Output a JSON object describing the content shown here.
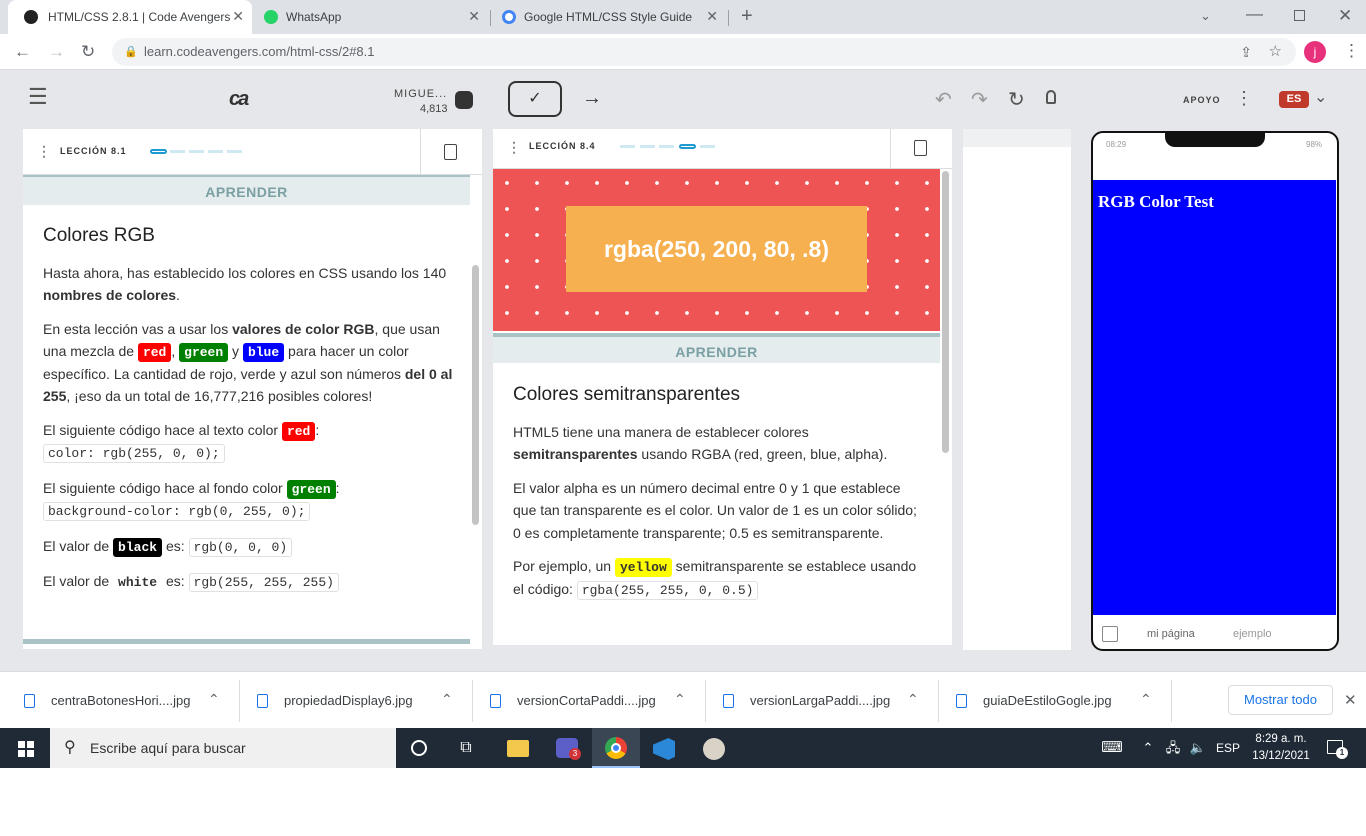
{
  "browser": {
    "tabs": [
      {
        "title": "HTML/CSS 2.8.1 | Code Avengers",
        "icon": "code-avengers-icon",
        "color": "#222222"
      },
      {
        "title": "WhatsApp",
        "icon": "whatsapp-icon",
        "color": "#25d366"
      },
      {
        "title": "Google HTML/CSS Style Guide",
        "icon": "google-icon",
        "color": "#4285f4"
      }
    ],
    "url": "learn.codeavengers.com/html-css/2#8.1",
    "profile_initial": "j"
  },
  "app": {
    "logo": "ca",
    "user_name": "MIGUE...",
    "user_points": "4,813",
    "support_label": "APOYO",
    "language": "ES"
  },
  "left_panel": {
    "lesson_label": "LECCIÓN 8.1",
    "section_label": "APRENDER",
    "title": "Colores RGB",
    "p1_a": "Hasta ahora, has establecido los colores en CSS usando los 140 ",
    "p1_b": "nombres de colores",
    "p1_c": ".",
    "p2_a": "En esta lección vas a usar los ",
    "p2_b": "valores de color RGB",
    "p2_c": ", que usan una mezcla de ",
    "tag_red": "red",
    "tag_green": "green",
    "tag_blue": "blue",
    "p2_d": " para hacer un color específico. La cantidad de rojo, verde y azul son números ",
    "p2_e": "del 0 al 255",
    "p2_f": ", ¡eso da un total de 16,777,216 posibles colores!",
    "p3_a": "El siguiente código hace al texto color ",
    "p3_code": "color: rgb(255, 0, 0);",
    "p4_a": "El siguiente código hace al fondo color ",
    "p4_code": "background-color: rgb(0, 255, 0);",
    "p5_a": "El valor de ",
    "tag_black": "black",
    "p5_b": " es: ",
    "p5_code": "rgb(0, 0, 0)",
    "p6_a": "El valor de ",
    "tag_white": "white",
    "p6_b": " es: ",
    "p6_code": "rgb(255, 255, 255)"
  },
  "mid_panel": {
    "lesson_label": "LECCIÓN 8.4",
    "banner_text": "rgba(250, 200, 80, .8)",
    "section_label": "APRENDER",
    "title": "Colores semitransparentes",
    "p1_a": "HTML5 tiene una manera de establecer colores ",
    "p1_b": "semitransparentes",
    "p1_c": " usando RGBA (red, green, blue, alpha).",
    "p2": "El valor alpha es un número decimal entre 0 y 1 que establece que tan transparente es el color. Un valor de 1 es un color sólido; 0 es completamente transparente; 0.5 es semitransparente.",
    "p3_a": "Por ejemplo, un ",
    "tag_yellow": "yellow",
    "p3_b": " semitransparente se establece usando el código: ",
    "p3_code": "rgba(255, 255, 0, 0.5)"
  },
  "phone": {
    "time": "08:29",
    "battery": "98%",
    "heading": "RGB Color Test",
    "bg_color": "#0000ff",
    "tab1": "mi página",
    "tab2": "ejemplo"
  },
  "downloads": {
    "items": [
      "centraBotonesHori....jpg",
      "propiedadDisplay6.jpg",
      "versionCortaPaddi....jpg",
      "versionLargaPaddi....jpg",
      "guiaDeEstiloGogle.jpg"
    ],
    "show_all": "Mostrar todo"
  },
  "taskbar": {
    "search_placeholder": "Escribe aquí para buscar",
    "lang": "ESP",
    "time": "8:29 a. m.",
    "date": "13/12/2021",
    "teams_badge": "3",
    "notif_count": "1"
  },
  "colors": {
    "red": "#ff0000",
    "green": "#008000",
    "blue": "#0000ff",
    "yellow": "#ffff00",
    "accent": "#1d9bd1",
    "lang_badge": "#c0392b"
  }
}
